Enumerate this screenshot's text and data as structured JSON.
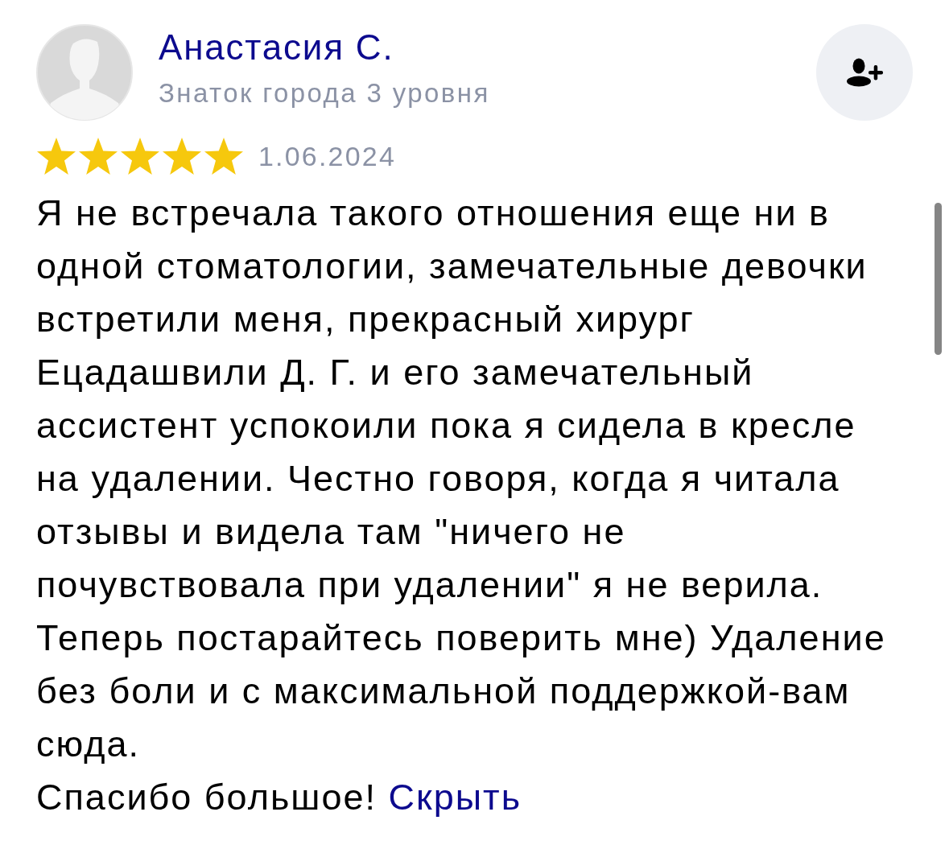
{
  "author": {
    "name": "Анастасия С.",
    "subtitle": "Знаток города 3 уровня"
  },
  "review": {
    "stars": 5,
    "date": "1.06.2024",
    "text": "Я не встречала такого отношения еще ни в одной стоматологии, замечательные девочки встретили меня, прекрасный хирург Ецадашвили Д. Г. и его замечательный ассистент успокоили пока я сидела в кресле на удалении. Честно говоря, когда я читала отзывы и видела там \"ничего не почувствовала при удалении\" я не верила. Теперь постарайтесь поверить мне) Удаление без боли и с максимальной поддержкой-вам сюда.",
    "closing": "Спасибо большое!",
    "hide_link": "Скрыть"
  }
}
